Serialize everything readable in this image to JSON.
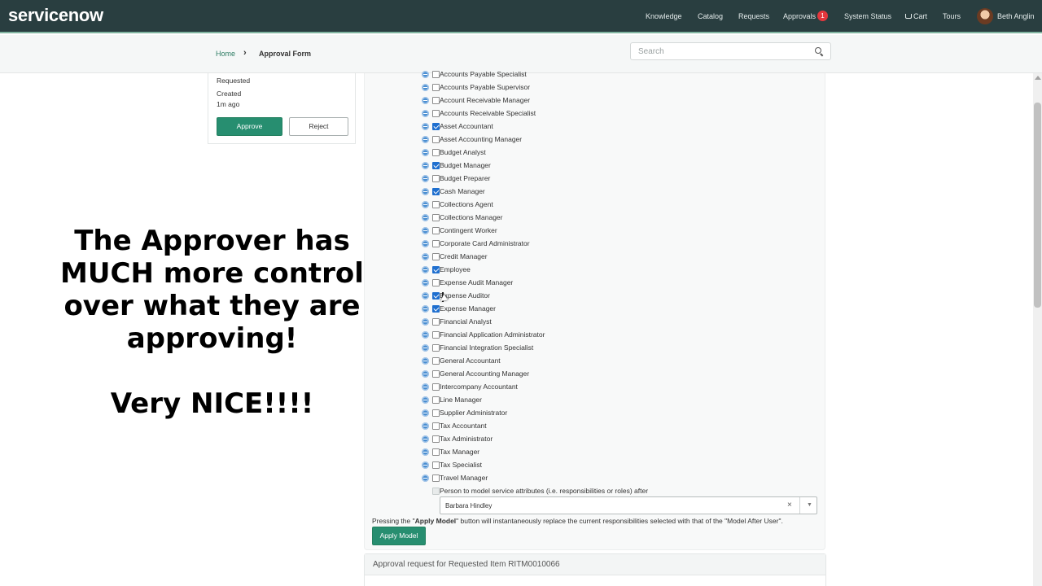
{
  "header": {
    "logo": "servicenow",
    "nav": {
      "knowledge": "Knowledge",
      "catalog": "Catalog",
      "requests": "Requests",
      "approvals": "Approvals",
      "approvals_count": "1",
      "system_status": "System Status",
      "cart": "Cart",
      "tours": "Tours",
      "user": "Beth Anglin"
    }
  },
  "breadcrumb": {
    "home": "Home",
    "separator": "›",
    "current": "Approval Form"
  },
  "search": {
    "placeholder": "Search"
  },
  "card": {
    "state": "Requested",
    "created_label": "Created",
    "created_value": "1m ago",
    "approve": "Approve",
    "reject": "Reject"
  },
  "caption": {
    "lines": [
      "The Approver has",
      "MUCH more control",
      "over what they are",
      "approving!"
    ],
    "line2": "Very NICE!!!!"
  },
  "roles": [
    {
      "label": "Accounts Payable Specialist",
      "checked": false
    },
    {
      "label": "Accounts Payable Supervisor",
      "checked": false
    },
    {
      "label": "Account Receivable Manager",
      "checked": false
    },
    {
      "label": "Accounts Receivable Specialist",
      "checked": false
    },
    {
      "label": "Asset Accountant",
      "checked": true
    },
    {
      "label": "Asset Accounting Manager",
      "checked": false
    },
    {
      "label": "Budget Analyst",
      "checked": false
    },
    {
      "label": "Budget Manager",
      "checked": true
    },
    {
      "label": "Budget Preparer",
      "checked": false
    },
    {
      "label": "Cash Manager",
      "checked": true
    },
    {
      "label": "Collections Agent",
      "checked": false
    },
    {
      "label": "Collections Manager",
      "checked": false
    },
    {
      "label": "Contingent Worker",
      "checked": false
    },
    {
      "label": "Corporate Card Administrator",
      "checked": false
    },
    {
      "label": "Credit Manager",
      "checked": false
    },
    {
      "label": "Employee",
      "checked": true
    },
    {
      "label": "Expense Audit Manager",
      "checked": false
    },
    {
      "label": "Expense Auditor",
      "checked": true
    },
    {
      "label": "Expense Manager",
      "checked": true
    },
    {
      "label": "Financial Analyst",
      "checked": false
    },
    {
      "label": "Financial Application Administrator",
      "checked": false
    },
    {
      "label": "Financial Integration Specialist",
      "checked": false
    },
    {
      "label": "General Accountant",
      "checked": false
    },
    {
      "label": "General Accounting Manager",
      "checked": false
    },
    {
      "label": "Intercompany Accountant",
      "checked": false
    },
    {
      "label": "Line Manager",
      "checked": false
    },
    {
      "label": "Supplier Administrator",
      "checked": false
    },
    {
      "label": "Tax Accountant",
      "checked": false
    },
    {
      "label": "Tax Administrator",
      "checked": false
    },
    {
      "label": "Tax Manager",
      "checked": false
    },
    {
      "label": "Tax Specialist",
      "checked": false
    },
    {
      "label": "Travel Manager",
      "checked": false
    }
  ],
  "model": {
    "label": "Person to model service attributes (i.e. responsibilities or roles) after",
    "value": "Barbara Hindley",
    "clear": "×",
    "note_prefix": "Pressing the \"",
    "note_bold": "Apply Model",
    "note_suffix": "\" button will instantaneously replace the current responsibilities selected with that of the \"Model After User\".",
    "apply": "Apply Model"
  },
  "request": {
    "title": "Approval request for Requested Item RITM0010066"
  },
  "colors": {
    "navbar": "#293e40",
    "accent": "#278e70",
    "link": "#2e7d64",
    "checkbox": "#1f6fcf",
    "badge": "#e3373d"
  }
}
